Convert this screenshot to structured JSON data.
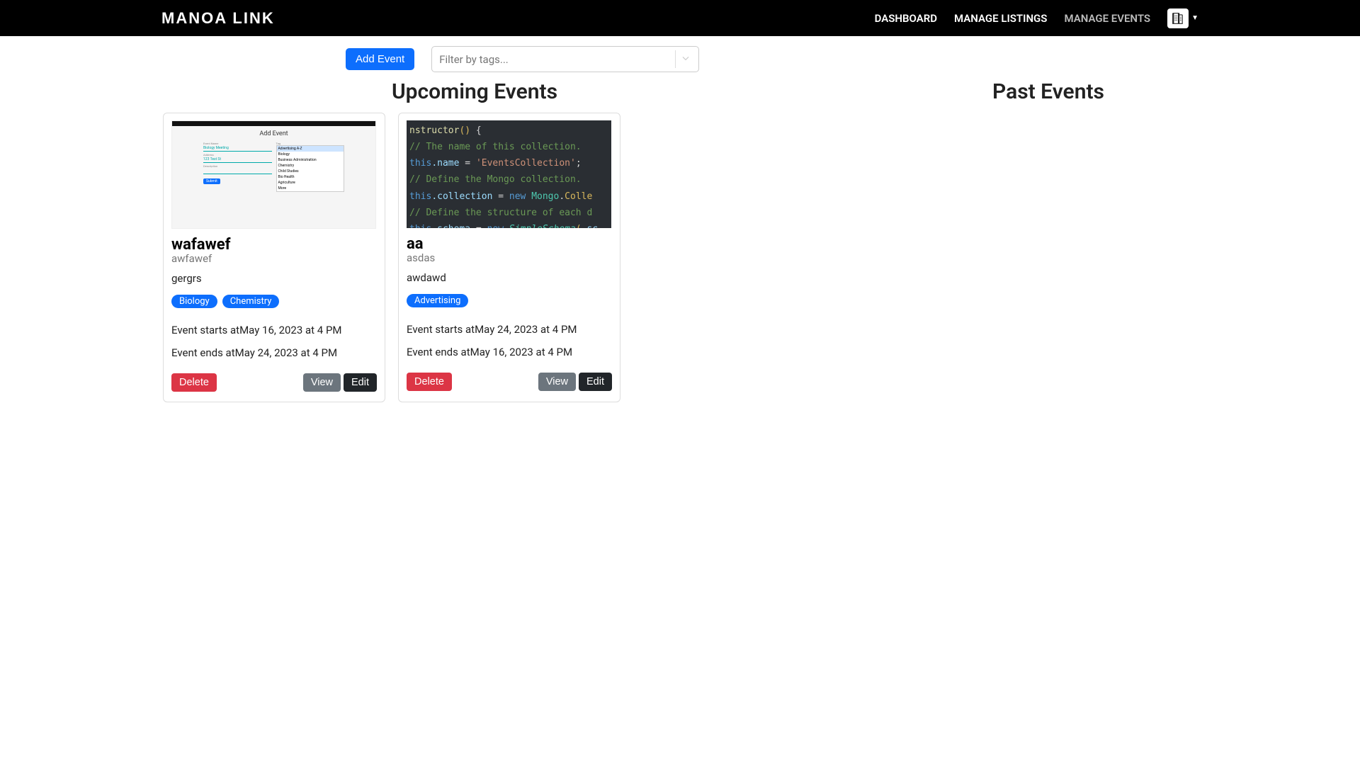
{
  "brand": "MANOA LINK",
  "nav": {
    "dashboard": "DASHBOARD",
    "manage_listings": "MANAGE LISTINGS",
    "manage_events": "MANAGE EVENTS"
  },
  "actions": {
    "add_event": "Add Event",
    "filter_placeholder": "Filter by tags..."
  },
  "sections": {
    "upcoming": "Upcoming Events",
    "past": "Past Events"
  },
  "labels": {
    "starts_prefix": "Event starts at",
    "ends_prefix": "Event ends at",
    "delete": "Delete",
    "view": "View",
    "edit": "Edit"
  },
  "thumb_form": {
    "title": "Add Event",
    "select_a": "Biology Meeting",
    "select_b": "Advertising A-Z",
    "btn": "Submit",
    "opts": [
      "Biology",
      "Business Administration",
      "Chemistry",
      "Child Studies",
      "Bio Health",
      "Agriculture",
      "More"
    ]
  },
  "code_thumb": {
    "l1_a": "nstructor",
    "l1_b": "()",
    "l1_c": " {",
    "l2": "// The name of this collection.",
    "l3_a": "this",
    "l3_b": ".name",
    "l3_c": " = ",
    "l3_d": "'EventsCollection'",
    "l3_e": ";",
    "l4": "// Define the Mongo collection.",
    "l5_a": "this",
    "l5_b": ".collection",
    "l5_c": " = ",
    "l5_d": "new ",
    "l5_e": "Mongo",
    "l5_f": ".",
    "l5_g": "Colle",
    "l6": "// Define the structure of each d",
    "l7_a": "this",
    "l7_b": ".schema",
    "l7_c": " = ",
    "l7_d": "new ",
    "l7_e": "SimpleSchema",
    "l7_f": "(",
    "l7_g": " sc"
  },
  "events": {
    "upcoming": [
      {
        "title": "wafawef",
        "subtitle": "awfawef",
        "description": "gergrs",
        "tags": [
          "Biology",
          "Chemistry"
        ],
        "start": "May 16, 2023 at 4 PM",
        "end": "May 24, 2023 at 4 PM"
      },
      {
        "title": "aa",
        "subtitle": "asdas",
        "description": "awdawd",
        "tags": [
          "Advertising"
        ],
        "start": "May 24, 2023 at 4 PM",
        "end": "May 16, 2023 at 4 PM"
      }
    ],
    "past": []
  }
}
